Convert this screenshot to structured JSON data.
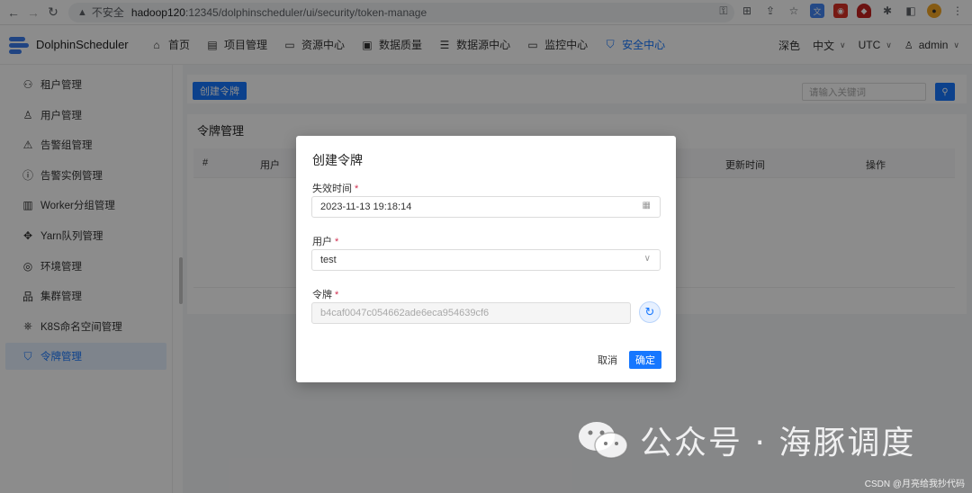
{
  "browser": {
    "insecure_label": "不安全",
    "url_host": "hadoop120",
    "url_path": ":12345/dolphinscheduler/ui/security/token-manage"
  },
  "header": {
    "brand": "DolphinScheduler",
    "menu": [
      {
        "label": "首页",
        "icon": "home-icon"
      },
      {
        "label": "项目管理",
        "icon": "project-icon"
      },
      {
        "label": "资源中心",
        "icon": "folder-icon"
      },
      {
        "label": "数据质量",
        "icon": "quality-icon"
      },
      {
        "label": "数据源中心",
        "icon": "database-icon"
      },
      {
        "label": "监控中心",
        "icon": "monitor-icon"
      },
      {
        "label": "安全中心",
        "icon": "shield-icon"
      }
    ],
    "theme": "深色",
    "language": "中文",
    "timezone": "UTC",
    "user": "admin"
  },
  "sidebar": {
    "items": [
      {
        "label": "租户管理",
        "icon": "tenant-icon"
      },
      {
        "label": "用户管理",
        "icon": "user-icon"
      },
      {
        "label": "告警组管理",
        "icon": "alert-icon"
      },
      {
        "label": "告警实例管理",
        "icon": "info-icon"
      },
      {
        "label": "Worker分组管理",
        "icon": "worker-icon"
      },
      {
        "label": "Yarn队列管理",
        "icon": "yarn-icon"
      },
      {
        "label": "环境管理",
        "icon": "environment-icon"
      },
      {
        "label": "集群管理",
        "icon": "cluster-icon"
      },
      {
        "label": "K8S命名空间管理",
        "icon": "k8s-icon"
      },
      {
        "label": "令牌管理",
        "icon": "token-icon"
      }
    ]
  },
  "main": {
    "create_button": "创建令牌",
    "search_placeholder": "请输入关键词",
    "card_title": "令牌管理",
    "columns": [
      "#",
      "用户",
      "更新时间",
      "操作"
    ]
  },
  "modal": {
    "title": "创建令牌",
    "expire_label": "失效时间",
    "expire_value": "2023-11-13 19:18:14",
    "user_label": "用户",
    "user_value": "test",
    "token_label": "令牌",
    "token_value": "b4caf0047c054662ade6eca954639cf6",
    "cancel": "取消",
    "confirm": "确定",
    "required_mark": "*"
  },
  "watermark": {
    "text": "公众号 · 海豚调度",
    "csdn": "CSDN @月亮给我抄代码"
  },
  "colors": {
    "primary": "#1677ff",
    "required": "#d03050"
  }
}
